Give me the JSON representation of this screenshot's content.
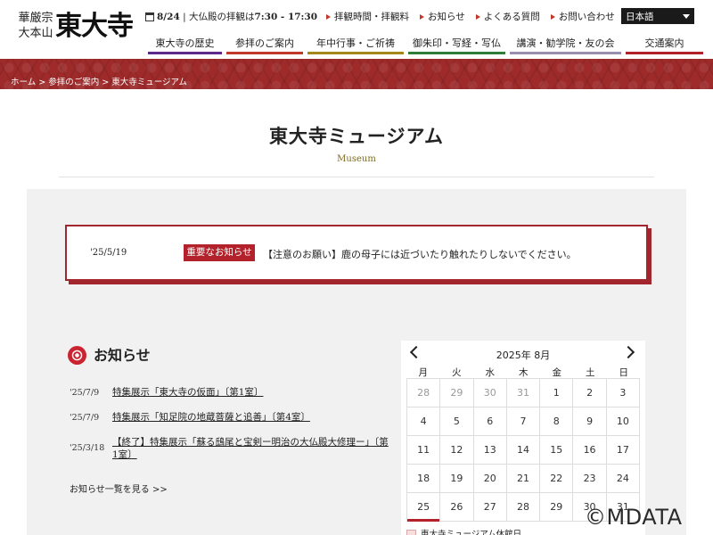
{
  "brand": {
    "logo_sub": "華厳宗\n大本山",
    "logo_main": "東大寺"
  },
  "top_info": {
    "date": "8/24",
    "hours_prefix": " | 大仏殿の拝観は",
    "hours": "7:30 - 17:30"
  },
  "top_links": [
    "拝観時間・拝観料",
    "お知らせ",
    "よくある質問",
    "お問い合わせ"
  ],
  "language": "日本語",
  "nav": [
    {
      "label": "東大寺の歴史",
      "color": "#5b2a8a"
    },
    {
      "label": "参拝のご案内",
      "color": "#c0392b"
    },
    {
      "label": "年中行事・ご祈祷",
      "color": "#a3871a"
    },
    {
      "label": "御朱印・写経・写仏",
      "color": "#2e7d3a"
    },
    {
      "label": "講演・勧学院・友の会",
      "color": "#9b8fb0"
    },
    {
      "label": "交通案内",
      "color": "#b3222a"
    }
  ],
  "breadcrumb": "ホーム > 参拝のご案内 > 東大寺ミュージアム",
  "page": {
    "title": "東大寺ミュージアム",
    "subtitle": "Museum"
  },
  "notice": {
    "date": "'25/5/19",
    "badge": "重要なお知らせ",
    "text": "【注意のお願い】鹿の母子には近づいたり触れたりしないでください。"
  },
  "news": {
    "title": "お知らせ",
    "items": [
      {
        "date": "'25/7/9",
        "text": "特集展示「東大寺の仮面」〔第1室〕"
      },
      {
        "date": "'25/7/9",
        "text": "特集展示「知足院の地蔵菩薩と追善」〔第4室〕"
      },
      {
        "date": "'25/3/18",
        "text": "【終了】特集展示「蘇る鴟尾と宝剣ー明治の大仏殿大修理ー」〔第1室〕"
      }
    ],
    "more": "お知らせ一覧を見る >>"
  },
  "calendar": {
    "month_label": "2025年 8月",
    "weekdays": [
      "月",
      "火",
      "水",
      "木",
      "金",
      "土",
      "日"
    ],
    "days": [
      [
        "28",
        "29",
        "30",
        "31",
        "1",
        "2",
        "3"
      ],
      [
        "4",
        "5",
        "6",
        "7",
        "8",
        "9",
        "10"
      ],
      [
        "11",
        "12",
        "13",
        "14",
        "15",
        "16",
        "17"
      ],
      [
        "18",
        "19",
        "20",
        "21",
        "22",
        "23",
        "24"
      ],
      [
        "25",
        "26",
        "27",
        "28",
        "29",
        "30",
        "31"
      ]
    ],
    "today": "25",
    "legend": "東大寺ミュージアム休館日"
  },
  "watermark": "©MDATA"
}
